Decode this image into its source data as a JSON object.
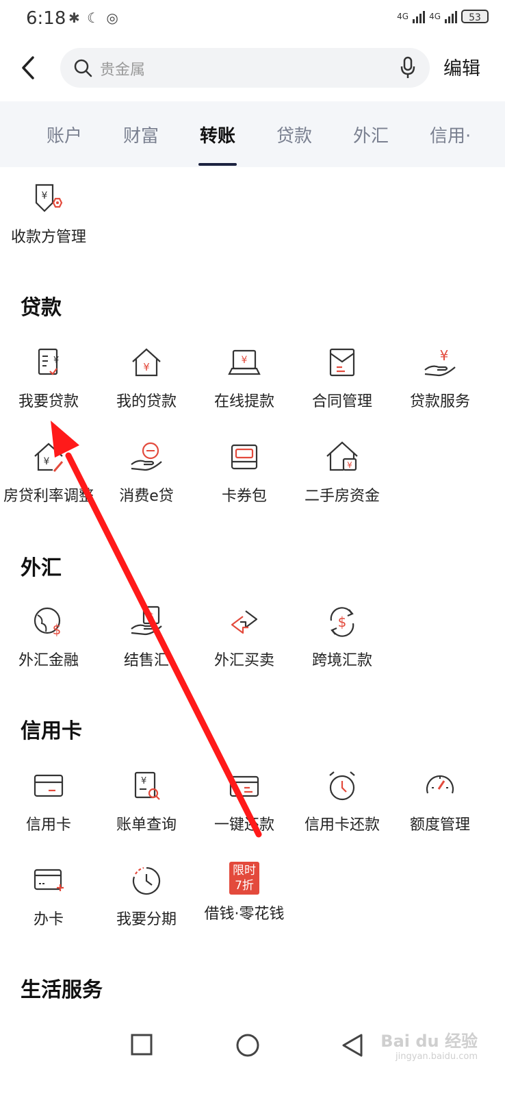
{
  "status": {
    "time": "6:18",
    "net1": "4G",
    "net2": "4G",
    "battery": "53"
  },
  "header": {
    "search_placeholder": "贵金属",
    "edit_label": "编辑"
  },
  "tabs": [
    "账户",
    "财富",
    "转账",
    "贷款",
    "外汇",
    "信用·"
  ],
  "active_tab": "转账",
  "transfer": {
    "items": [
      "收款方管理"
    ]
  },
  "sections": {
    "loan": {
      "title": "贷款",
      "items": [
        "我要贷款",
        "我的贷款",
        "在线提款",
        "合同管理",
        "贷款服务",
        "房贷利率调整",
        "消费e贷",
        "卡券包",
        "二手房资金"
      ]
    },
    "forex": {
      "title": "外汇",
      "items": [
        "外汇金融",
        "结售汇",
        "外汇买卖",
        "跨境汇款"
      ]
    },
    "credit": {
      "title": "信用卡",
      "items": [
        "信用卡",
        "账单查询",
        "一键还款",
        "信用卡还款",
        "额度管理",
        "办卡",
        "我要分期",
        "借钱·零花钱"
      ],
      "promo_badge_line1": "限时",
      "promo_badge_line2": "7折"
    },
    "life": {
      "title": "生活服务"
    }
  },
  "watermark": {
    "brand": "Bai du 经验",
    "url": "jingyan.baidu.com"
  },
  "colors": {
    "accent_red": "#e34a3c",
    "annotation_arrow": "#ff1a1a",
    "tab_bg": "#f4f6f9"
  }
}
